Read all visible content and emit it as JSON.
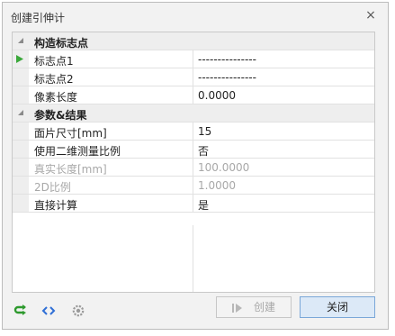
{
  "window": {
    "title": "创建引伸计",
    "close_glyph": "×"
  },
  "categories": [
    {
      "label": "构造标志点",
      "expanded": true
    },
    {
      "label": "参数&结果",
      "expanded": true
    }
  ],
  "rows": [
    {
      "name": "标志点1",
      "value": "---------------",
      "disabled": false,
      "active": true
    },
    {
      "name": "标志点2",
      "value": "---------------",
      "disabled": false,
      "active": false
    },
    {
      "name": "像素长度",
      "value": "0.0000",
      "disabled": false,
      "active": false
    },
    {
      "name": "面片尺寸[mm]",
      "value": "15",
      "disabled": false,
      "active": false
    },
    {
      "name": "使用二维测量比例",
      "value": "否",
      "disabled": false,
      "active": false
    },
    {
      "name": "真实长度[mm]",
      "value": "100.0000",
      "disabled": true,
      "active": false
    },
    {
      "name": "2D比例",
      "value": "1.0000",
      "disabled": true,
      "active": false
    },
    {
      "name": "直接计算",
      "value": "是",
      "disabled": false,
      "active": false
    }
  ],
  "footer": {
    "icons": [
      "refresh-arrow-icon",
      "code-brackets-icon",
      "settings-gear-icon"
    ],
    "create_label": "创建",
    "close_label": "关闭"
  },
  "colors": {
    "active_arrow": "#3aa83a",
    "refresh_icon": "#2e9a2e",
    "code_icon": "#2f6fd6",
    "gear_icon": "#9a9a9a",
    "close_button_bg": "#dce9f7",
    "close_button_border": "#7aa7d8"
  }
}
